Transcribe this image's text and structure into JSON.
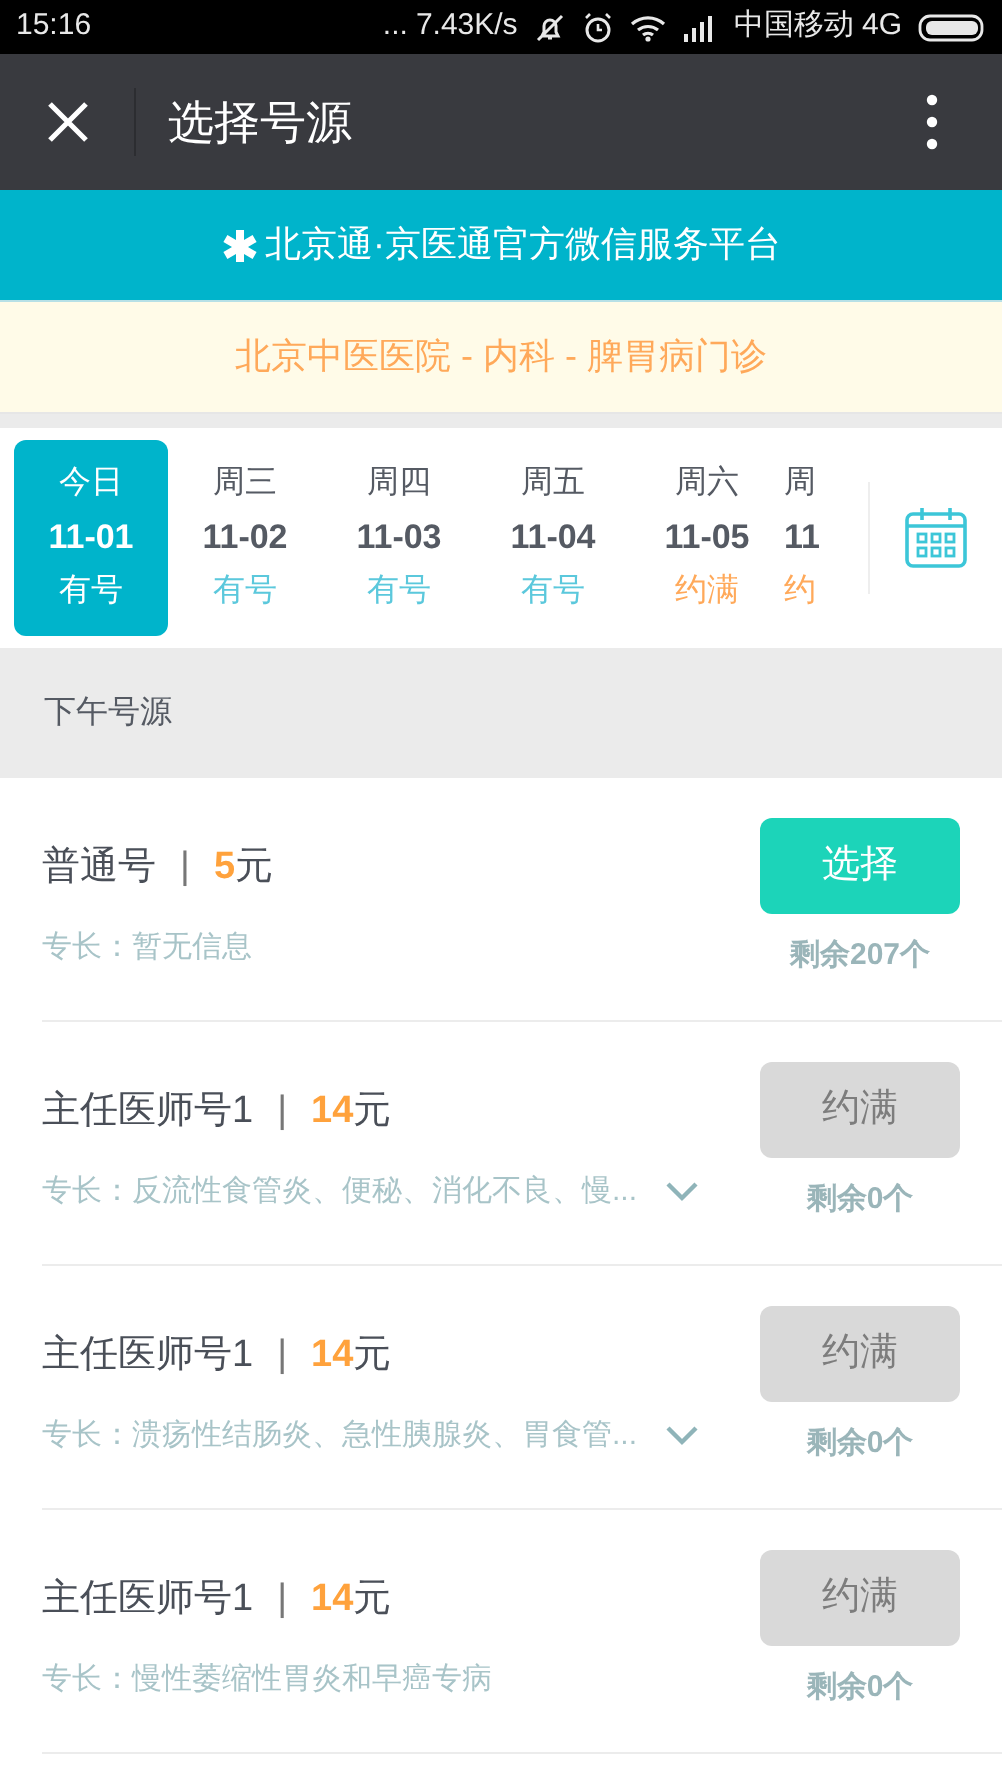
{
  "status_bar": {
    "time": "15:16",
    "dots": "...",
    "speed": "7.43K/s",
    "carrier": "中国移动 4G"
  },
  "header": {
    "title": "选择号源"
  },
  "banner": {
    "text": "北京通·京医通官方微信服务平台"
  },
  "department": {
    "text": "北京中医医院 - 内科 - 脾胃病门诊"
  },
  "dates": [
    {
      "weekday": "今日",
      "date": "11-01",
      "status": "有号",
      "kind": "available",
      "selected": true
    },
    {
      "weekday": "周三",
      "date": "11-02",
      "status": "有号",
      "kind": "available",
      "selected": false
    },
    {
      "weekday": "周四",
      "date": "11-03",
      "status": "有号",
      "kind": "available",
      "selected": false
    },
    {
      "weekday": "周五",
      "date": "11-04",
      "status": "有号",
      "kind": "available",
      "selected": false
    },
    {
      "weekday": "周六",
      "date": "11-05",
      "status": "约满",
      "kind": "full",
      "selected": false
    },
    {
      "weekday": "周",
      "date": "11",
      "status": "约",
      "kind": "full",
      "selected": false
    }
  ],
  "section": {
    "title": "下午号源"
  },
  "slots": [
    {
      "name": "普通号",
      "separator": "|",
      "price": "5",
      "unit": "元",
      "specialty": "专长：暂无信息",
      "expandable": false,
      "button": "选择",
      "kind": "available",
      "remaining": "剩余207个"
    },
    {
      "name": "主任医师号1",
      "separator": "|",
      "price": "14",
      "unit": "元",
      "specialty": "专长：反流性食管炎、便秘、消化不良、慢...",
      "expandable": true,
      "button": "约满",
      "kind": "full",
      "remaining": "剩余0个"
    },
    {
      "name": "主任医师号1",
      "separator": "|",
      "price": "14",
      "unit": "元",
      "specialty": "专长：溃疡性结肠炎、急性胰腺炎、胃食管...",
      "expandable": true,
      "button": "约满",
      "kind": "full",
      "remaining": "剩余0个"
    },
    {
      "name": "主任医师号1",
      "separator": "|",
      "price": "14",
      "unit": "元",
      "specialty": "专长：慢性萎缩性胃炎和早癌专病",
      "expandable": false,
      "button": "约满",
      "kind": "full",
      "remaining": "剩余0个"
    }
  ]
}
